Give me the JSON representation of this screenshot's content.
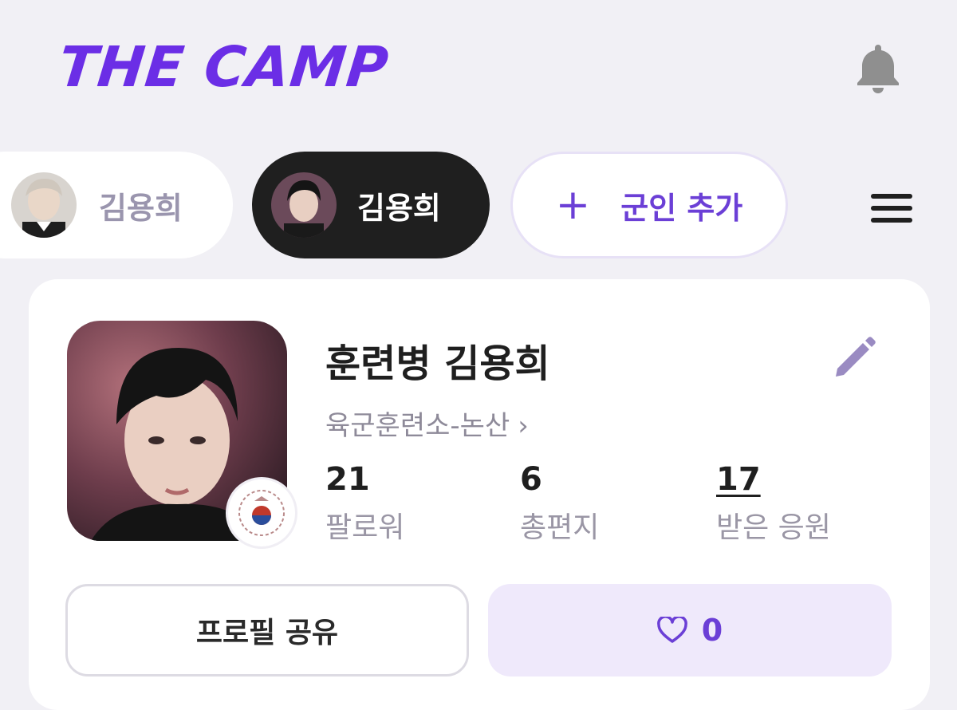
{
  "header": {
    "logo_text": "THE CAMP",
    "brand_color": "#6b2ee6",
    "notification_icon": "bell-icon"
  },
  "soldier_tabs": [
    {
      "label": "김용희",
      "selected": false
    },
    {
      "label": "김용희",
      "selected": true
    }
  ],
  "add_soldier": {
    "label": "군인 추가",
    "plus": "+"
  },
  "menu_icon": "hamburger-menu-icon",
  "profile": {
    "name": "훈련병 김용희",
    "unit": "육군훈련소-논산",
    "unit_chevron": "›",
    "stats": [
      {
        "value": "21",
        "label": "팔로워"
      },
      {
        "value": "6",
        "label": "총편지"
      },
      {
        "value": "17",
        "label": "받은 응원"
      }
    ]
  },
  "actions": {
    "share_label": "프로필 공유",
    "like_count": "0"
  },
  "accent_color": "#6b3fd6"
}
